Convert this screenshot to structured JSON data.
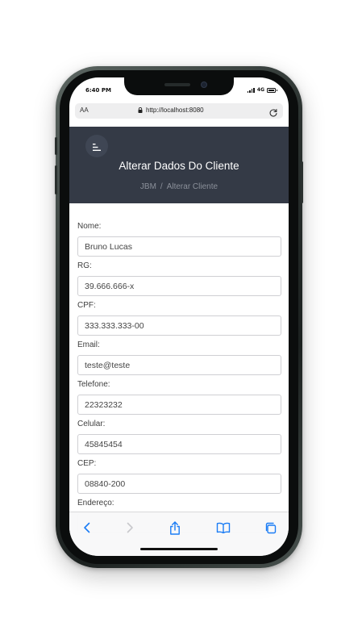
{
  "status_bar": {
    "time": "6:40 PM",
    "network": "4G"
  },
  "browser": {
    "text_size_label": "AA",
    "url": "http://localhost:8080"
  },
  "header": {
    "title": "Alterar Dados Do Cliente",
    "breadcrumb": [
      "JBM",
      "Alterar Cliente"
    ],
    "breadcrumb_separator": "/"
  },
  "form": {
    "fields": [
      {
        "label": "Nome:",
        "value": "Bruno Lucas"
      },
      {
        "label": "RG:",
        "value": "39.666.666-x"
      },
      {
        "label": "CPF:",
        "value": "333.333.333-00"
      },
      {
        "label": "Email:",
        "value": "teste@teste"
      },
      {
        "label": "Telefone:",
        "value": "22323232"
      },
      {
        "label": "Celular:",
        "value": "45845454"
      },
      {
        "label": "CEP:",
        "value": "08840-200"
      },
      {
        "label": "Endereço:",
        "value": ""
      }
    ]
  },
  "toolbar": {
    "items": [
      "back-icon",
      "forward-icon",
      "share-icon",
      "bookmarks-icon",
      "tabs-icon"
    ]
  },
  "colors": {
    "header_bg": "#343a46",
    "toolbar_accent": "#1a7cf5",
    "toolbar_disabled": "#c8c8cc"
  }
}
